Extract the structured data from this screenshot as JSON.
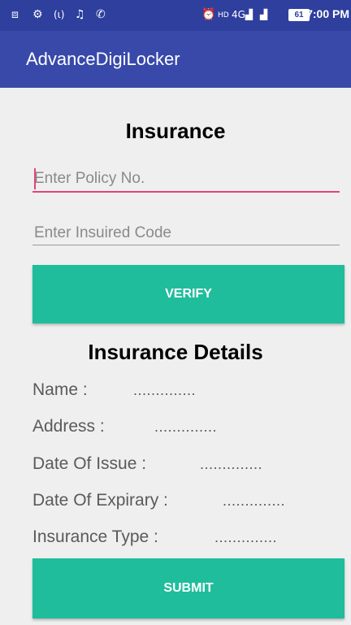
{
  "status_bar": {
    "icons": [
      "screenshot-icon",
      "settings-icon",
      "hotspot-icon",
      "music-icon",
      "phone-icon",
      "alarm-icon",
      "hd-icon",
      "signal-4g-icon",
      "signal-icon",
      "battery-icon"
    ],
    "battery": "61",
    "time": "7:00 PM"
  },
  "app_bar": {
    "title": "AdvanceDigiLocker"
  },
  "insurance": {
    "heading": "Insurance",
    "policy_placeholder": "Enter Policy No.",
    "code_placeholder": "Enter Insuired Code",
    "verify_label": "VERIFY"
  },
  "details": {
    "heading": "Insurance Details",
    "rows": [
      {
        "label": "Name :",
        "value": ".............."
      },
      {
        "label": "Address :",
        "value": ".............."
      },
      {
        "label": "Date Of Issue :",
        "value": ".............."
      },
      {
        "label": "Date Of Expirary :",
        "value": ".............."
      },
      {
        "label": "Insurance Type :",
        "value": ".............."
      }
    ],
    "submit_label": "SUBMIT"
  },
  "colors": {
    "status_bar": "#2f3f9e",
    "app_bar": "#3849aa",
    "button": "#1fbd9b",
    "accent": "#e0457a",
    "background": "#efefef"
  }
}
